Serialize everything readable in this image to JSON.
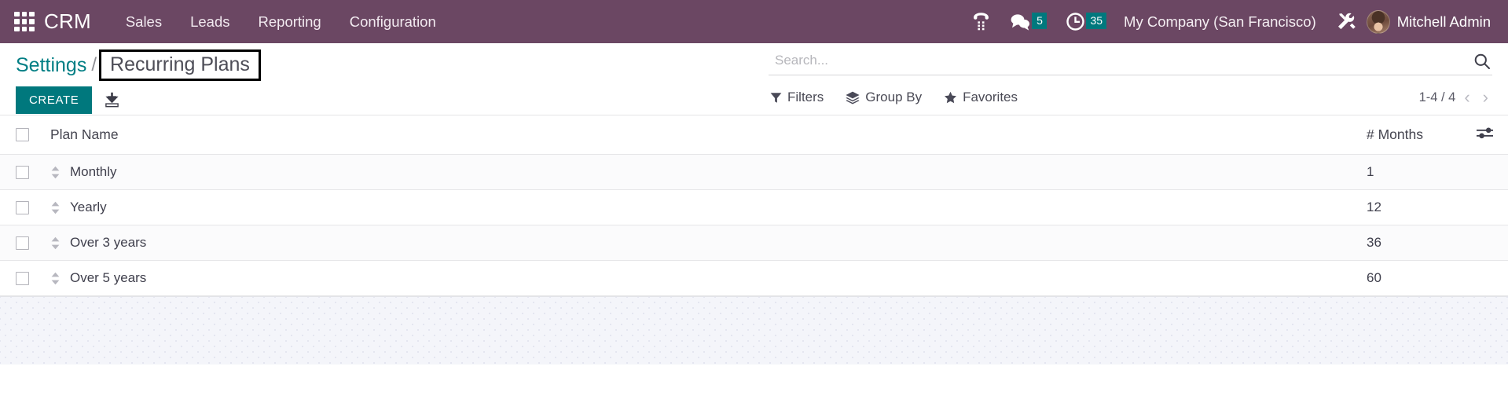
{
  "navbar": {
    "apps_icon": "apps-grid-icon",
    "brand": "CRM",
    "menu": [
      {
        "label": "Sales"
      },
      {
        "label": "Leads"
      },
      {
        "label": "Reporting"
      },
      {
        "label": "Configuration"
      }
    ],
    "systray": {
      "voip_icon": "phone-dialpad-icon",
      "messages_icon": "chat-bubble-icon",
      "messages_count": "5",
      "activities_icon": "clock-icon",
      "activities_count": "35",
      "company": "My Company (San Francisco)",
      "debug_icon": "tools-wrench-icon",
      "avatar_icon": "user-avatar",
      "user": "Mitchell Admin"
    },
    "colors": {
      "background": "#6b4763",
      "badge": "#00787d",
      "text": "#ffffff"
    }
  },
  "control_panel": {
    "breadcrumb": {
      "root": "Settings",
      "separator": "/",
      "current": "Recurring Plans"
    },
    "create_label": "CREATE",
    "import_icon": "import-download-icon",
    "search": {
      "placeholder": "Search...",
      "value": "",
      "search_icon": "search-icon"
    },
    "toolbar": [
      {
        "label": "Filters",
        "icon": "filter-funnel-icon"
      },
      {
        "label": "Group By",
        "icon": "layers-icon"
      },
      {
        "label": "Favorites",
        "icon": "star-icon"
      }
    ],
    "pager": {
      "range": "1-4 / 4",
      "prev_icon": "chevron-left-icon",
      "next_icon": "chevron-right-icon"
    },
    "accent_color": "#00787d"
  },
  "list": {
    "columns": [
      {
        "key": "select",
        "label": ""
      },
      {
        "key": "name",
        "label": "Plan Name"
      },
      {
        "key": "months",
        "label": "# Months"
      }
    ],
    "optional_columns_icon": "sliders-toggle-icon",
    "select_all_icon": "checkbox-unchecked",
    "rows": [
      {
        "name": "Monthly",
        "months": "1"
      },
      {
        "name": "Yearly",
        "months": "12"
      },
      {
        "name": "Over 3 years",
        "months": "36"
      },
      {
        "name": "Over 5 years",
        "months": "60"
      }
    ]
  }
}
